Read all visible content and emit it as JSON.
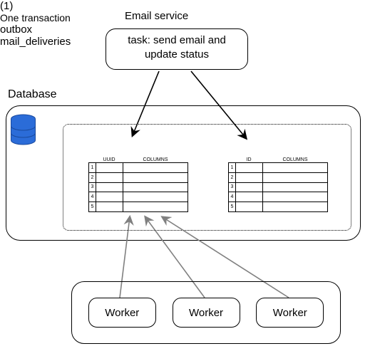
{
  "title": "Email service",
  "task": {
    "line1": "task: send email and",
    "line2": "update status"
  },
  "step1_label": "(1)",
  "database": {
    "label": "Database",
    "transaction_label": "One transaction",
    "icon_color": "#2b6cd8",
    "tables": {
      "outbox": {
        "title": "outbox",
        "id_header": "UUID",
        "cols_header": "COLUMNS",
        "row_numbers": [
          "1",
          "2",
          "3",
          "4",
          "5"
        ]
      },
      "mail_deliveries": {
        "title": "mail_deliveries",
        "id_header": "ID",
        "cols_header": "COLUMNS",
        "row_numbers": [
          "1",
          "2",
          "3",
          "4",
          "5"
        ]
      }
    }
  },
  "workers": {
    "labels": [
      "Worker",
      "Worker",
      "Worker"
    ]
  },
  "arrows": {
    "task_to_outbox": {
      "from": "task-box",
      "to": "outbox"
    },
    "task_to_maildeliv": {
      "from": "task-box",
      "to": "mail_deliveries"
    },
    "workers_to_outbox": [
      {
        "from": "worker-1",
        "to": "outbox"
      },
      {
        "from": "worker-2",
        "to": "outbox"
      },
      {
        "from": "worker-3",
        "to": "outbox"
      }
    ]
  }
}
